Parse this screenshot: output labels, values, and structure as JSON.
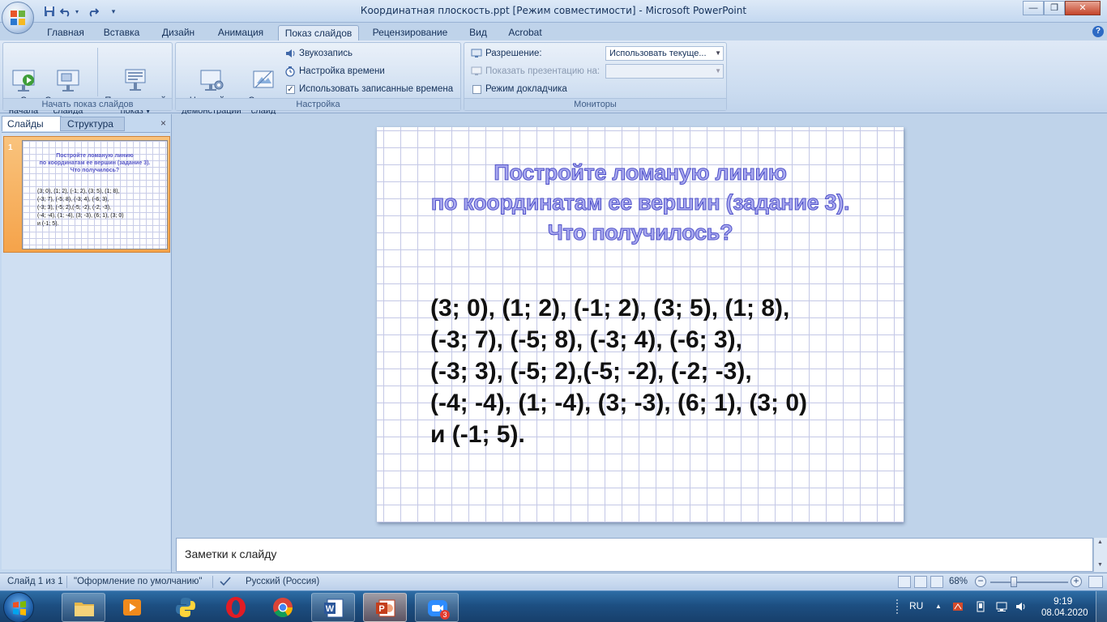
{
  "window": {
    "title": "Координатная плоскость.ppt [Режим совместимости] - Microsoft PowerPoint"
  },
  "ribbon_tabs": [
    "Главная",
    "Вставка",
    "Дизайн",
    "Анимация",
    "Показ слайдов",
    "Рецензирование",
    "Вид",
    "Acrobat"
  ],
  "active_tab": "Показ слайдов",
  "ribbon": {
    "start_group": {
      "label": "Начать показ слайдов",
      "from_beginning": "С\nначала",
      "from_current": "С текущего\nслайда",
      "custom_show": "Произвольный\nпоказ ▾"
    },
    "setup_group": {
      "label": "Настройка",
      "setup_show": "Настройка\nдемонстрации",
      "hide_slide": "Скрыть\nслайд",
      "record_narration": "Звукозапись",
      "rehearse_timings": "Настройка времени",
      "use_timings": "Использовать записанные времена",
      "use_timings_checked": true
    },
    "monitors_group": {
      "label": "Мониторы",
      "resolution_label": "Разрешение:",
      "resolution_value": "Использовать текуще...",
      "show_on_label": "Показать презентацию на:",
      "show_on_value": "",
      "presenter_view": "Режим докладчика",
      "presenter_view_checked": false
    }
  },
  "left_pane": {
    "tab_slides": "Слайды",
    "tab_outline": "Структура",
    "close": "×",
    "thumbnail": {
      "number": "1",
      "title": "Постройте ломаную линию\nпо координатам ее вершин (задание 3).\nЧто получилось?",
      "body": "(3; 0), (1; 2), (-1; 2), (3; 5), (1; 8),\n(-3; 7), (-5; 8), (-3; 4), (-6; 3),\n(-3; 3), (-5; 2),(-5; -2), (-2; -3),\n(-4; -4), (1; -4), (3; -3), (6; 1), (3; 0)\nи (-1; 5)."
    }
  },
  "slide": {
    "title": "Постройте ломаную  линию\nпо координатам  ее вершин (задание 3).\nЧто получилось?",
    "body": "(3; 0), (1; 2), (-1; 2), (3; 5), (1; 8),\n(-3; 7), (-5; 8), (-3; 4), (-6; 3),\n(-3; 3), (-5; 2),(-5; -2), (-2; -3),\n(-4; -4), (1; -4), (3; -3), (6; 1), (3; 0)\nи (-1; 5)."
  },
  "notes": {
    "placeholder": "Заметки к слайду"
  },
  "statusbar": {
    "slide_counter": "Слайд 1 из 1",
    "theme": "\"Оформление по умолчанию\"",
    "language": "Русский (Россия)",
    "zoom": "68%",
    "zoom_fraction": 0.68
  },
  "taskbar": {
    "apps": [
      "explorer-icon",
      "media-player-icon",
      "python-icon",
      "opera-icon",
      "chrome-icon",
      "word-icon",
      "powerpoint-icon",
      "zoom-icon"
    ],
    "badge": "3",
    "language": "RU",
    "time": "9:19",
    "date": "08.04.2020"
  },
  "colors": {
    "title_fill": "#a9a9ef",
    "title_stroke": "#4e50c8",
    "grid": "#c4c8e6",
    "taskbar": "#1d4f82"
  }
}
